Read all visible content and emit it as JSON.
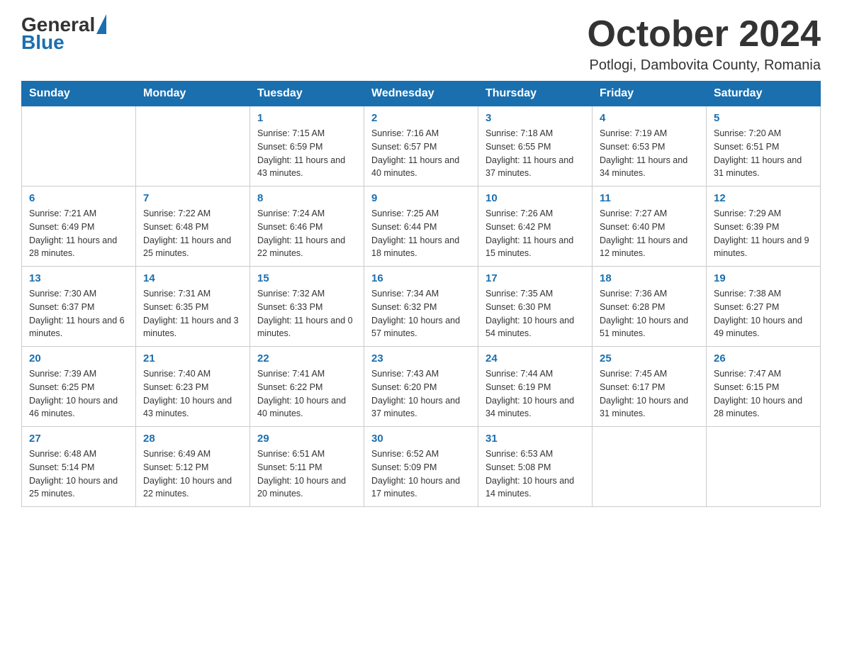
{
  "header": {
    "logo_general": "General",
    "logo_blue": "Blue",
    "month_title": "October 2024",
    "location": "Potlogi, Dambovita County, Romania"
  },
  "days_of_week": [
    "Sunday",
    "Monday",
    "Tuesday",
    "Wednesday",
    "Thursday",
    "Friday",
    "Saturday"
  ],
  "weeks": [
    [
      {
        "day": "",
        "sunrise": "",
        "sunset": "",
        "daylight": ""
      },
      {
        "day": "",
        "sunrise": "",
        "sunset": "",
        "daylight": ""
      },
      {
        "day": "1",
        "sunrise": "Sunrise: 7:15 AM",
        "sunset": "Sunset: 6:59 PM",
        "daylight": "Daylight: 11 hours and 43 minutes."
      },
      {
        "day": "2",
        "sunrise": "Sunrise: 7:16 AM",
        "sunset": "Sunset: 6:57 PM",
        "daylight": "Daylight: 11 hours and 40 minutes."
      },
      {
        "day": "3",
        "sunrise": "Sunrise: 7:18 AM",
        "sunset": "Sunset: 6:55 PM",
        "daylight": "Daylight: 11 hours and 37 minutes."
      },
      {
        "day": "4",
        "sunrise": "Sunrise: 7:19 AM",
        "sunset": "Sunset: 6:53 PM",
        "daylight": "Daylight: 11 hours and 34 minutes."
      },
      {
        "day": "5",
        "sunrise": "Sunrise: 7:20 AM",
        "sunset": "Sunset: 6:51 PM",
        "daylight": "Daylight: 11 hours and 31 minutes."
      }
    ],
    [
      {
        "day": "6",
        "sunrise": "Sunrise: 7:21 AM",
        "sunset": "Sunset: 6:49 PM",
        "daylight": "Daylight: 11 hours and 28 minutes."
      },
      {
        "day": "7",
        "sunrise": "Sunrise: 7:22 AM",
        "sunset": "Sunset: 6:48 PM",
        "daylight": "Daylight: 11 hours and 25 minutes."
      },
      {
        "day": "8",
        "sunrise": "Sunrise: 7:24 AM",
        "sunset": "Sunset: 6:46 PM",
        "daylight": "Daylight: 11 hours and 22 minutes."
      },
      {
        "day": "9",
        "sunrise": "Sunrise: 7:25 AM",
        "sunset": "Sunset: 6:44 PM",
        "daylight": "Daylight: 11 hours and 18 minutes."
      },
      {
        "day": "10",
        "sunrise": "Sunrise: 7:26 AM",
        "sunset": "Sunset: 6:42 PM",
        "daylight": "Daylight: 11 hours and 15 minutes."
      },
      {
        "day": "11",
        "sunrise": "Sunrise: 7:27 AM",
        "sunset": "Sunset: 6:40 PM",
        "daylight": "Daylight: 11 hours and 12 minutes."
      },
      {
        "day": "12",
        "sunrise": "Sunrise: 7:29 AM",
        "sunset": "Sunset: 6:39 PM",
        "daylight": "Daylight: 11 hours and 9 minutes."
      }
    ],
    [
      {
        "day": "13",
        "sunrise": "Sunrise: 7:30 AM",
        "sunset": "Sunset: 6:37 PM",
        "daylight": "Daylight: 11 hours and 6 minutes."
      },
      {
        "day": "14",
        "sunrise": "Sunrise: 7:31 AM",
        "sunset": "Sunset: 6:35 PM",
        "daylight": "Daylight: 11 hours and 3 minutes."
      },
      {
        "day": "15",
        "sunrise": "Sunrise: 7:32 AM",
        "sunset": "Sunset: 6:33 PM",
        "daylight": "Daylight: 11 hours and 0 minutes."
      },
      {
        "day": "16",
        "sunrise": "Sunrise: 7:34 AM",
        "sunset": "Sunset: 6:32 PM",
        "daylight": "Daylight: 10 hours and 57 minutes."
      },
      {
        "day": "17",
        "sunrise": "Sunrise: 7:35 AM",
        "sunset": "Sunset: 6:30 PM",
        "daylight": "Daylight: 10 hours and 54 minutes."
      },
      {
        "day": "18",
        "sunrise": "Sunrise: 7:36 AM",
        "sunset": "Sunset: 6:28 PM",
        "daylight": "Daylight: 10 hours and 51 minutes."
      },
      {
        "day": "19",
        "sunrise": "Sunrise: 7:38 AM",
        "sunset": "Sunset: 6:27 PM",
        "daylight": "Daylight: 10 hours and 49 minutes."
      }
    ],
    [
      {
        "day": "20",
        "sunrise": "Sunrise: 7:39 AM",
        "sunset": "Sunset: 6:25 PM",
        "daylight": "Daylight: 10 hours and 46 minutes."
      },
      {
        "day": "21",
        "sunrise": "Sunrise: 7:40 AM",
        "sunset": "Sunset: 6:23 PM",
        "daylight": "Daylight: 10 hours and 43 minutes."
      },
      {
        "day": "22",
        "sunrise": "Sunrise: 7:41 AM",
        "sunset": "Sunset: 6:22 PM",
        "daylight": "Daylight: 10 hours and 40 minutes."
      },
      {
        "day": "23",
        "sunrise": "Sunrise: 7:43 AM",
        "sunset": "Sunset: 6:20 PM",
        "daylight": "Daylight: 10 hours and 37 minutes."
      },
      {
        "day": "24",
        "sunrise": "Sunrise: 7:44 AM",
        "sunset": "Sunset: 6:19 PM",
        "daylight": "Daylight: 10 hours and 34 minutes."
      },
      {
        "day": "25",
        "sunrise": "Sunrise: 7:45 AM",
        "sunset": "Sunset: 6:17 PM",
        "daylight": "Daylight: 10 hours and 31 minutes."
      },
      {
        "day": "26",
        "sunrise": "Sunrise: 7:47 AM",
        "sunset": "Sunset: 6:15 PM",
        "daylight": "Daylight: 10 hours and 28 minutes."
      }
    ],
    [
      {
        "day": "27",
        "sunrise": "Sunrise: 6:48 AM",
        "sunset": "Sunset: 5:14 PM",
        "daylight": "Daylight: 10 hours and 25 minutes."
      },
      {
        "day": "28",
        "sunrise": "Sunrise: 6:49 AM",
        "sunset": "Sunset: 5:12 PM",
        "daylight": "Daylight: 10 hours and 22 minutes."
      },
      {
        "day": "29",
        "sunrise": "Sunrise: 6:51 AM",
        "sunset": "Sunset: 5:11 PM",
        "daylight": "Daylight: 10 hours and 20 minutes."
      },
      {
        "day": "30",
        "sunrise": "Sunrise: 6:52 AM",
        "sunset": "Sunset: 5:09 PM",
        "daylight": "Daylight: 10 hours and 17 minutes."
      },
      {
        "day": "31",
        "sunrise": "Sunrise: 6:53 AM",
        "sunset": "Sunset: 5:08 PM",
        "daylight": "Daylight: 10 hours and 14 minutes."
      },
      {
        "day": "",
        "sunrise": "",
        "sunset": "",
        "daylight": ""
      },
      {
        "day": "",
        "sunrise": "",
        "sunset": "",
        "daylight": ""
      }
    ]
  ]
}
